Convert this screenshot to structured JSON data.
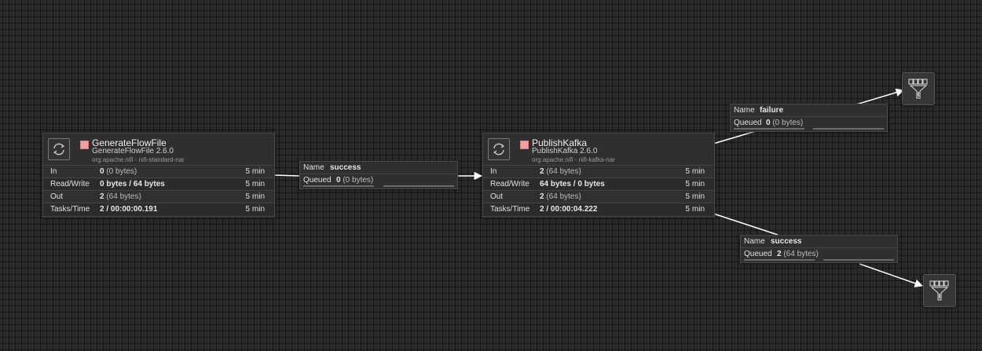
{
  "processors": {
    "generate": {
      "name": "GenerateFlowFile",
      "type": "GenerateFlowFile 2.6.0",
      "bundle": "org.apache.nifi - nifi-standard-nar",
      "state": "stopped",
      "stats": {
        "in": {
          "label": "In",
          "count": "0",
          "size": "(0 bytes)",
          "period": "5 min"
        },
        "read_write": {
          "label": "Read/Write",
          "value": "0 bytes / 64 bytes",
          "period": "5 min"
        },
        "out": {
          "label": "Out",
          "count": "2",
          "size": "(64 bytes)",
          "period": "5 min"
        },
        "tasks": {
          "label": "Tasks/Time",
          "value": "2 / 00:00:00.191",
          "period": "5 min"
        }
      }
    },
    "publish": {
      "name": "PublishKafka",
      "type": "PublishKafka 2.6.0",
      "bundle": "org.apache.nifi - nifi-kafka-nar",
      "state": "stopped",
      "stats": {
        "in": {
          "label": "In",
          "count": "2",
          "size": "(64 bytes)",
          "period": "5 min"
        },
        "read_write": {
          "label": "Read/Write",
          "value": "64 bytes / 0 bytes",
          "period": "5 min"
        },
        "out": {
          "label": "Out",
          "count": "2",
          "size": "(64 bytes)",
          "period": "5 min"
        },
        "tasks": {
          "label": "Tasks/Time",
          "value": "2 / 00:00:04.222",
          "period": "5 min"
        }
      }
    }
  },
  "connections": {
    "gen_to_publish": {
      "name_key": "Name",
      "name": "success",
      "queued_key": "Queued",
      "queued_count": "0",
      "queued_size": "(0 bytes)"
    },
    "publish_failure": {
      "name_key": "Name",
      "name": "failure",
      "queued_key": "Queued",
      "queued_count": "0",
      "queued_size": "(0 bytes)"
    },
    "publish_success": {
      "name_key": "Name",
      "name": "success",
      "queued_key": "Queued",
      "queued_count": "2",
      "queued_size": "(64 bytes)"
    }
  },
  "colors": {
    "canvas": "#2a2a2a",
    "grid": "#151515",
    "stopped_indicator": "#f0a0a0",
    "edge": "#ffffff"
  },
  "icons": {
    "processor": "processor-icon",
    "run_state": "stopped-icon",
    "funnel": "funnel-icon"
  }
}
